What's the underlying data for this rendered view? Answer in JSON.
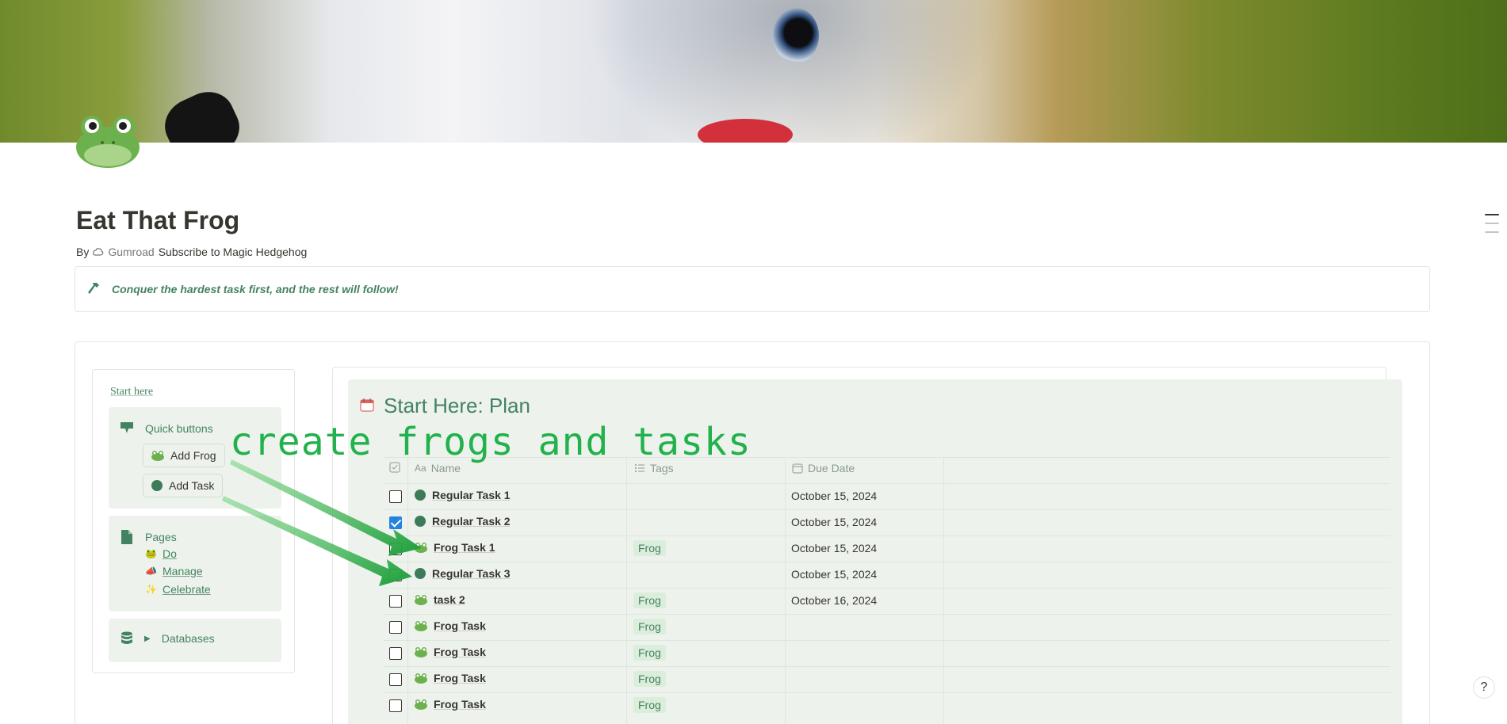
{
  "page": {
    "title": "Eat That Frog",
    "byline": {
      "by": "By",
      "source": "Gumroad",
      "link": "Subscribe to Magic Hedgehog"
    },
    "callout": "Conquer the hardest task first, and the rest will follow!"
  },
  "nav": {
    "start_here": "Start here",
    "quick_buttons": "Quick buttons",
    "add_frog": "Add Frog",
    "add_task": "Add Task",
    "pages_label": "Pages",
    "pages": [
      "Do",
      "Manage",
      "Celebrate"
    ],
    "databases": "Databases"
  },
  "table": {
    "title": "Start Here: Plan",
    "columns": {
      "name": "Name",
      "tags": "Tags",
      "due": "Due Date"
    },
    "rows": [
      {
        "name": "Regular Task 1",
        "type": "task",
        "checked": false,
        "tag": "",
        "due": "October 15, 2024"
      },
      {
        "name": "Regular Task 2",
        "type": "task",
        "checked": true,
        "tag": "",
        "due": "October 15, 2024"
      },
      {
        "name": "Frog Task 1",
        "type": "frog",
        "checked": false,
        "tag": "Frog",
        "due": "October 15, 2024"
      },
      {
        "name": "Regular Task 3",
        "type": "task",
        "checked": false,
        "tag": "",
        "due": "October 15, 2024"
      },
      {
        "name": "task 2",
        "type": "frog",
        "checked": false,
        "tag": "Frog",
        "due": "October 16, 2024"
      },
      {
        "name": "Frog Task",
        "type": "frog",
        "checked": false,
        "tag": "Frog",
        "due": ""
      },
      {
        "name": "Frog Task",
        "type": "frog",
        "checked": false,
        "tag": "Frog",
        "due": ""
      },
      {
        "name": "Frog Task",
        "type": "frog",
        "checked": false,
        "tag": "Frog",
        "due": ""
      },
      {
        "name": "Frog Task",
        "type": "frog",
        "checked": false,
        "tag": "Frog",
        "due": ""
      }
    ]
  },
  "annotation": "create frogs and tasks",
  "colors": {
    "accent_green": "#448361",
    "block_bg": "#edf3ec",
    "checkbox_blue": "#2383e2",
    "annotation": "#22b14c"
  }
}
